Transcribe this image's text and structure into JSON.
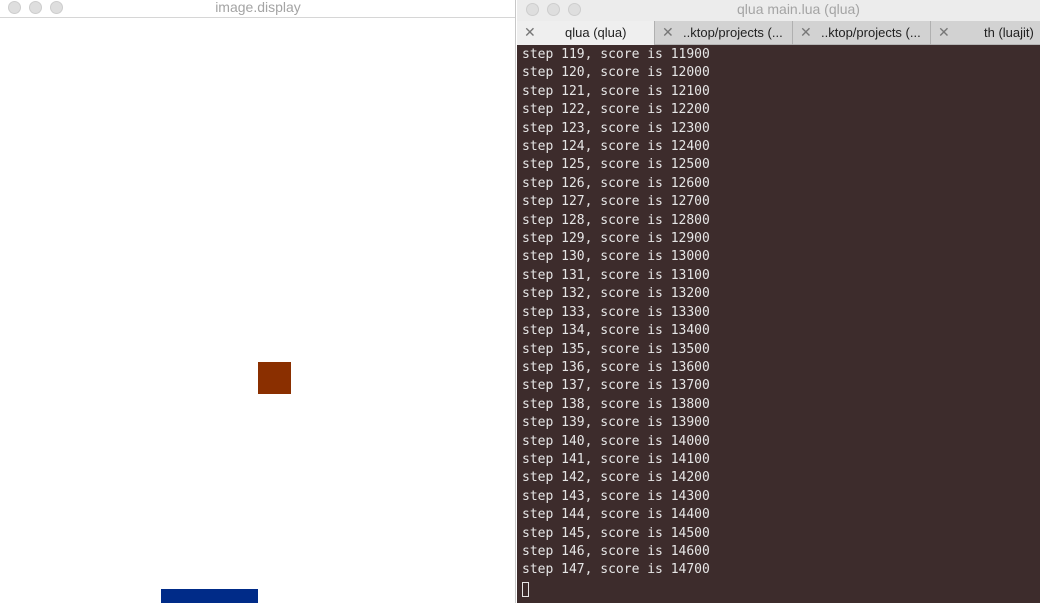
{
  "left_window": {
    "title": "image.display",
    "ball_color": "#8a2f00",
    "paddle_color": "#002b88"
  },
  "right_window": {
    "title": "qlua main.lua (qlua)",
    "tabs": [
      {
        "label": "qlua (qlua)",
        "active": true
      },
      {
        "label": "..ktop/projects (...",
        "active": false
      },
      {
        "label": "..ktop/projects (...",
        "active": false
      },
      {
        "label": "th (luajit)",
        "active": false
      }
    ],
    "terminal_lines": [
      "step 119, score is 11900",
      "step 120, score is 12000",
      "step 121, score is 12100",
      "step 122, score is 12200",
      "step 123, score is 12300",
      "step 124, score is 12400",
      "step 125, score is 12500",
      "step 126, score is 12600",
      "step 127, score is 12700",
      "step 128, score is 12800",
      "step 129, score is 12900",
      "step 130, score is 13000",
      "step 131, score is 13100",
      "step 132, score is 13200",
      "step 133, score is 13300",
      "step 134, score is 13400",
      "step 135, score is 13500",
      "step 136, score is 13600",
      "step 137, score is 13700",
      "step 138, score is 13800",
      "step 139, score is 13900",
      "step 140, score is 14000",
      "step 141, score is 14100",
      "step 142, score is 14200",
      "step 143, score is 14300",
      "step 144, score is 14400",
      "step 145, score is 14500",
      "step 146, score is 14600",
      "step 147, score is 14700"
    ],
    "terminal_bg": "#3d2c2c",
    "terminal_fg": "#e6e6e6"
  }
}
